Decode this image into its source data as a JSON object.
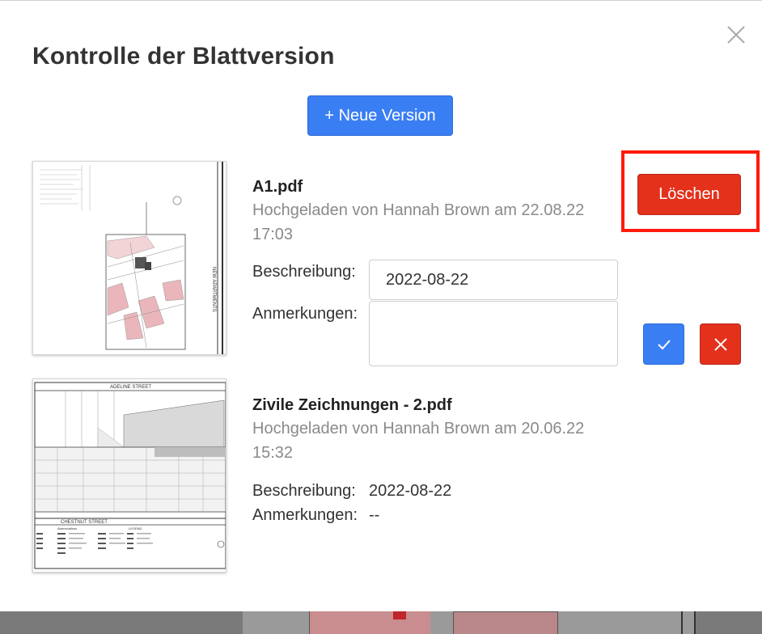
{
  "dialog": {
    "title": "Kontrolle der Blattversion",
    "new_version_label": "+ Neue Version",
    "close_icon": "close-icon"
  },
  "versions": [
    {
      "file_name": "A1.pdf",
      "uploaded_line1": "Hochgeladen von Hannah Brown am 22.08.22",
      "uploaded_line2": "17:03",
      "description_label": "Beschreibung:",
      "description_value": "2022-08-22",
      "notes_label": "Anmerkungen:",
      "notes_value": "",
      "delete_label": "Löschen",
      "confirm_icon": "check-icon",
      "cancel_icon": "x-icon",
      "thumbnail_texts": [
        "NEW APARTMENTS"
      ]
    },
    {
      "file_name": "Zivile Zeichnungen - 2.pdf",
      "uploaded_line1": "Hochgeladen von Hannah Brown am 20.06.22",
      "uploaded_line2": "15:32",
      "description_label": "Beschreibung:",
      "description_value": "2022-08-22",
      "notes_label": "Anmerkungen:",
      "notes_value": "--",
      "thumbnail_texts": [
        "ADELINE STREET",
        "CHESTNUT STREET",
        "Abbreviations",
        "LEGEND"
      ]
    }
  ],
  "colors": {
    "primary": "#3a7ef3",
    "danger": "#e3311c",
    "highlight": "#ff1a0d"
  }
}
